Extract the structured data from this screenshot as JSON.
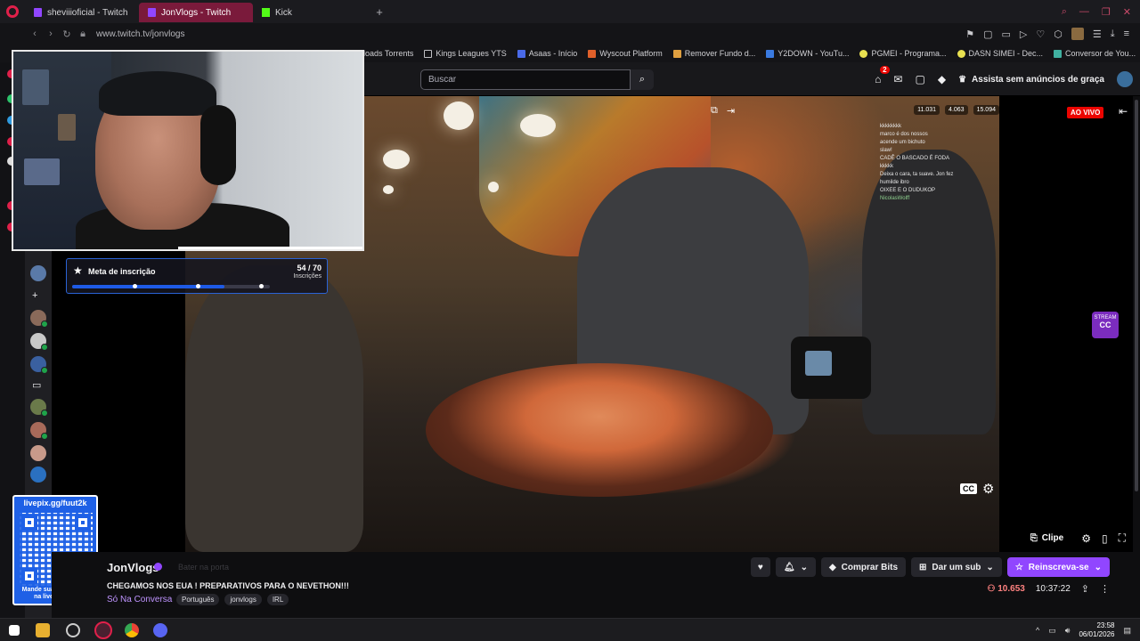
{
  "browser": {
    "tabs": [
      {
        "label": "sheviiioficial - Twitch",
        "active": false
      },
      {
        "label": "JonVlogs - Twitch",
        "active": true
      },
      {
        "label": "Kick",
        "active": false
      }
    ],
    "url": "www.twitch.tv/jonvlogs",
    "bookmarks": [
      "loads Torrents",
      "Kings Leagues YTS",
      "Asaas - Início",
      "Wyscout Platform",
      "Remover Fundo d...",
      "Y2DOWN - YouTu...",
      "PGMEI - Programa...",
      "DASN SIMEI - Dec...",
      "Conversor de You..."
    ]
  },
  "twitch_nav": {
    "search_placeholder": "Buscar",
    "notification_count": "2",
    "ad_free_label": "Assista sem anúncios de graça"
  },
  "player": {
    "live_badge": "AO VIVO",
    "overlay_stats": [
      "11.031",
      "4.063",
      "15.094"
    ],
    "overlay_chat": [
      {
        "name": "",
        "text": "kkkkkkkk"
      },
      {
        "name": "",
        "text": "marco é dos nossos"
      },
      {
        "name": "",
        "text": "acende um bichuto"
      },
      {
        "name": "",
        "text": "slaw!"
      },
      {
        "name": "",
        "text": "CADÊ O BASCADO É FODA"
      },
      {
        "name": "",
        "text": "kkkkk"
      },
      {
        "name": "",
        "text": "Deixa o cara, ta suave. Jon fez"
      },
      {
        "name": "",
        "text": "humilde ibro"
      },
      {
        "name": "",
        "text": "OIXEE E O DUDUKOP"
      },
      {
        "name": "NicolasWolff",
        "text": ""
      }
    ],
    "stream_badge": "STREAM",
    "cc_label": "CC",
    "clip_label": "Clipe"
  },
  "sub_goal": {
    "title": "Meta de inscrição",
    "count": "54 / 70",
    "unit": "Inscrições",
    "progress": 0.77
  },
  "pix": {
    "url": "livepix.gg/fuut2k",
    "message_line1": "Mande sua mensagem",
    "message_line2": "na live via pix!"
  },
  "channel": {
    "name": "JonVlogs",
    "bater": "Bater na porta",
    "title": "CHEGAMOS NOS EUA ! PREPARATIVOS PARA O NEVETHON!!!",
    "category": "Só Na Conversa",
    "tags": [
      "Português",
      "jonvlogs",
      "IRL"
    ],
    "buttons": {
      "bits": "Comprar Bits",
      "sub": "Dar um sub",
      "resub": "Reinscreva-se"
    },
    "viewers": "10.653",
    "uptime": "10:37:22"
  },
  "taskbar": {
    "time": "23:58",
    "date": "06/01/2026"
  },
  "colors": {
    "twitch_purple": "#9146ff",
    "live_red": "#eb0400",
    "goal_blue": "#1e5ae6"
  }
}
